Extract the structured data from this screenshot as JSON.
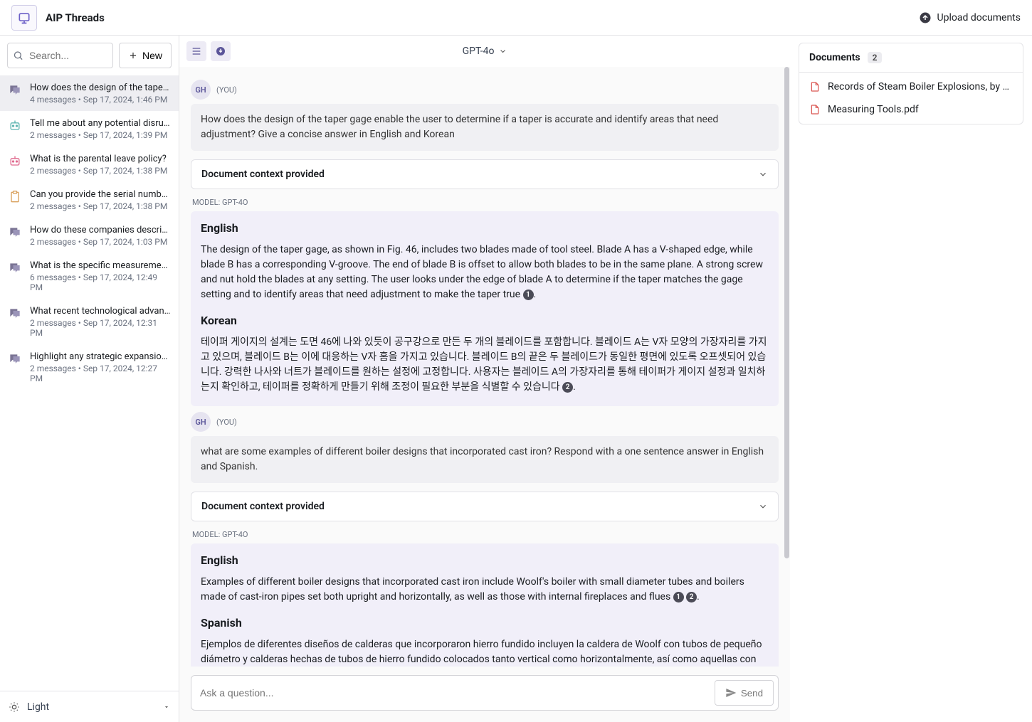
{
  "app": {
    "title": "AIP Threads"
  },
  "header": {
    "upload": "Upload documents"
  },
  "sidebar": {
    "search_placeholder": "Search...",
    "new_label": "New",
    "theme_label": "Light",
    "threads": [
      {
        "title": "How does the design of the taper gage enable the user to determine…",
        "meta": "4 messages • Sep 17, 2024, 1:46 PM",
        "icon": "chat",
        "active": true
      },
      {
        "title": "Tell me about any potential disruptions…",
        "meta": "2 messages • Sep 17, 2024, 1:39 PM",
        "icon": "robot"
      },
      {
        "title": "What is the parental leave policy?",
        "meta": "2 messages • Sep 17, 2024, 1:38 PM",
        "icon": "robot-pink"
      },
      {
        "title": "Can you provide the serial numbers…",
        "meta": "2 messages • Sep 17, 2024, 1:38 PM",
        "icon": "clipboard"
      },
      {
        "title": "How do these companies describe…",
        "meta": "2 messages • Sep 17, 2024, 1:03 PM",
        "icon": "chat"
      },
      {
        "title": "What is the specific measurement…",
        "meta": "6 messages • Sep 17, 2024, 12:49 PM",
        "icon": "chat"
      },
      {
        "title": "What recent technological advancements…",
        "meta": "2 messages • Sep 17, 2024, 12:31 PM",
        "icon": "chat"
      },
      {
        "title": "Highlight any strategic expansion…",
        "meta": "2 messages • Sep 17, 2024, 12:27 PM",
        "icon": "chat"
      }
    ]
  },
  "conversation": {
    "model": "GPT-4o",
    "from_initials": "GH",
    "from_you": "(YOU)",
    "context_label": "Document context provided",
    "model_label": "MODEL: GPT-4O",
    "q1": "How does the design of the taper gage enable the user to determine if a taper is accurate and identify areas that need adjustment? Give a concise answer in English and Korean",
    "a1": {
      "h_en": "English",
      "p_en": "The design of the taper gage, as shown in Fig. 46, includes two blades made of tool steel. Blade A has a V-shaped edge, while blade B has a corresponding V-groove. The end of blade B is offset to allow both blades to be in the same plane. A strong screw and nut hold the blades at any setting. The user looks under the edge of blade A to determine if the taper matches the gage setting and to identify areas that need adjustment to make the taper true ",
      "h_ko": "Korean",
      "p_ko": "테이퍼 게이지의 설계는 도면 46에 나와 있듯이 공구강으로 만든 두 개의 블레이드를 포함합니다. 블레이드 A는 V자 모양의 가장자리를 가지고 있으며, 블레이드 B는 이에 대응하는 V자 홈을 가지고 있습니다. 블레이드 B의 끝은 두 블레이드가 동일한 평면에 있도록 오프셋되어 있습니다. 강력한 나사와 너트가 블레이드를 원하는 설정에 고정합니다. 사용자는 블레이드 A의 가장자리를 통해 테이퍼가 게이지 설정과 일치하는지 확인하고, 테이퍼를 정확하게 만들기 위해 조정이 필요한 부분을 식별할 수 있습니다 "
    },
    "q2": "what are some examples of different boiler designs that incorporated cast iron? Respond with a one sentence answer in English and Spanish.",
    "a2": {
      "h_en": "English",
      "p_en": "Examples of different boiler designs that incorporated cast iron include Woolf's boiler with small diameter tubes and boilers made of cast-iron pipes set both upright and horizontally, as well as those with internal fireplaces and flues ",
      "h_es": "Spanish",
      "p_es": "Ejemplos de diferentes diseños de calderas que incorporaron hierro fundido incluyen la caldera de Woolf con tubos de pequeño diámetro y calderas hechas de tubos de hierro fundido colocados tanto vertical como horizontalmente, así como aquellas con chimeneas y conductos internos "
    },
    "composer_placeholder": "Ask a question...",
    "send_label": "Send"
  },
  "documents": {
    "title": "Documents",
    "count": "2",
    "items": [
      "Records of Steam Boiler Explosions, by Edward…",
      "Measuring Tools.pdf"
    ]
  }
}
